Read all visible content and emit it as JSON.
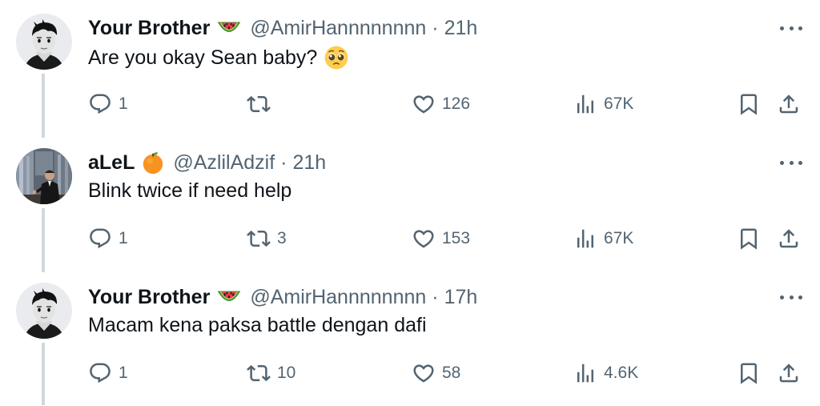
{
  "tweets": [
    {
      "name": "Your Brother",
      "badge_icon": "watermelon-icon",
      "handle": "@AmirHannnnnnnn",
      "separator": "·",
      "time": "21h",
      "text": "Are you okay Sean baby?",
      "text_emoji_icon": "pleading-face-icon",
      "replies": "1",
      "retweets": "",
      "likes": "126",
      "views": "67K"
    },
    {
      "name": "aLeL",
      "badge_icon": "orange-circle-icon",
      "handle": "@AzlilAdzif",
      "separator": "·",
      "time": "21h",
      "text": "Blink twice if need help",
      "replies": "1",
      "retweets": "3",
      "likes": "153",
      "views": "67K"
    },
    {
      "name": "Your Brother",
      "badge_icon": "watermelon-icon",
      "handle": "@AmirHannnnnnnn",
      "separator": "·",
      "time": "17h",
      "text": "Macam kena paksa battle dengan dafi",
      "replies": "1",
      "retweets": "10",
      "likes": "58",
      "views": "4.6K"
    }
  ],
  "icons": {
    "reply": "reply-icon",
    "retweet": "retweet-icon",
    "like": "heart-icon",
    "views": "views-chart-icon",
    "bookmark": "bookmark-icon",
    "share": "share-icon",
    "more": "more-dots-icon"
  },
  "colors": {
    "text_primary": "#0f1419",
    "text_secondary": "#536471",
    "thread_line": "#cfd9de",
    "background": "#ffffff"
  }
}
